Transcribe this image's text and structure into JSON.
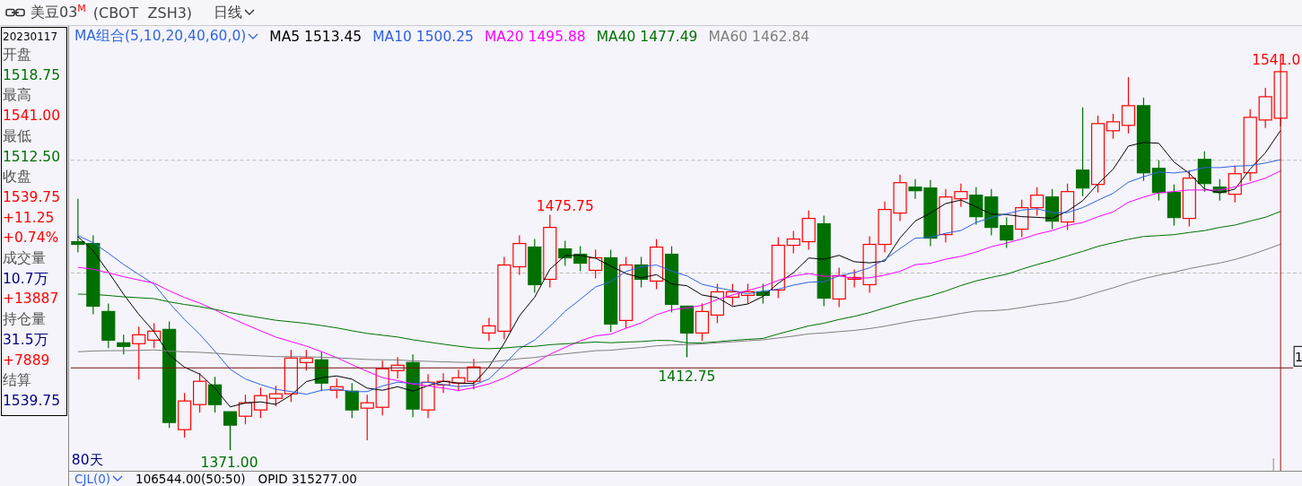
{
  "header": {
    "symbol": "美豆03",
    "superscript": "M",
    "code": "(CBOT  ZSH3)",
    "period": "日线"
  },
  "info_panel": {
    "date": "20230117",
    "rows": [
      {
        "kind": "label",
        "text": "开盘"
      },
      {
        "kind": "value",
        "text": "1518.75",
        "color": "#007000"
      },
      {
        "kind": "label",
        "text": "最高"
      },
      {
        "kind": "value",
        "text": "1541.00",
        "color": "#ff0000"
      },
      {
        "kind": "label",
        "text": "最低"
      },
      {
        "kind": "value",
        "text": "1512.50",
        "color": "#007000"
      },
      {
        "kind": "label",
        "text": "收盘"
      },
      {
        "kind": "value",
        "text": "1539.75",
        "color": "#ff0000"
      },
      {
        "kind": "value",
        "text": "+11.25",
        "color": "#ff0000"
      },
      {
        "kind": "value",
        "text": "+0.74%",
        "color": "#ff0000"
      },
      {
        "kind": "label",
        "text": "成交量"
      },
      {
        "kind": "value",
        "text": "10.7万",
        "color": "#000080"
      },
      {
        "kind": "value",
        "text": "+13887",
        "color": "#ff0000"
      },
      {
        "kind": "label",
        "text": "持仓量"
      },
      {
        "kind": "value",
        "text": "31.5万",
        "color": "#000080"
      },
      {
        "kind": "value",
        "text": "+7889",
        "color": "#ff0000"
      },
      {
        "kind": "label",
        "text": "结算"
      },
      {
        "kind": "value",
        "text": "1539.75",
        "color": "#000080"
      }
    ]
  },
  "ma_legend": {
    "title": "MA组合(5,10,20,40,60,0)",
    "items": [
      {
        "label": "MA5 1513.45",
        "color": "#000000"
      },
      {
        "label": "MA10 1500.25",
        "color": "#3060e0"
      },
      {
        "label": "MA20 1495.88",
        "color": "#ff00ff"
      },
      {
        "label": "MA40 1477.49",
        "color": "#007000"
      },
      {
        "label": "MA60 1462.84",
        "color": "#808080"
      }
    ]
  },
  "chart": {
    "peak_label": "1475.75",
    "trough_label": "1412.75",
    "low_label": "1371.00",
    "high_label": "1541.0",
    "crosshair_value": "1",
    "days": "80天"
  },
  "indicator_bar": {
    "title": "CJL(0)",
    "items": [
      "106544.00(50:50)",
      "OPID 315277.00"
    ]
  }
}
